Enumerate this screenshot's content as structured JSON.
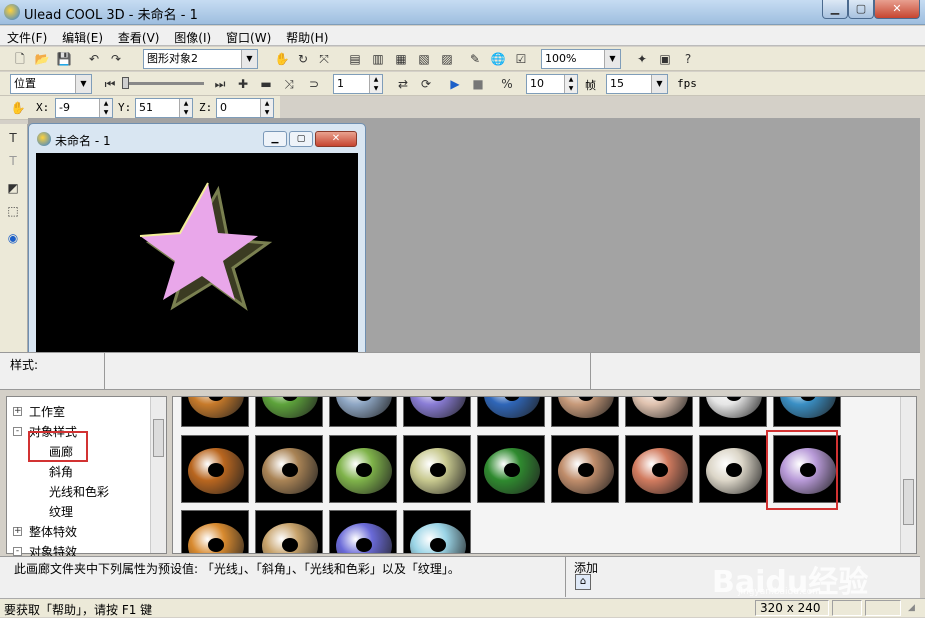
{
  "window": {
    "title": "Ulead COOL 3D - 未命名 - 1"
  },
  "menu": [
    "文件(F)",
    "编辑(E)",
    "查看(V)",
    "图像(I)",
    "窗口(W)",
    "帮助(H)"
  ],
  "toolbar1": {
    "object_select": "图形对象2",
    "zoom": "100%"
  },
  "toolbar2": {
    "mode_select": "位置",
    "frame": "1",
    "frames_total": "10",
    "frames_label": "帧",
    "fps_value": "15",
    "fps_label": "fps"
  },
  "toolbar3": {
    "x_label": "X:",
    "x_value": "-9",
    "y_label": "Y:",
    "y_value": "51",
    "z_label": "Z:",
    "z_value": "0"
  },
  "document": {
    "title": "未命名 - 1"
  },
  "style_panel": {
    "label": "样式:"
  },
  "tree": {
    "items": [
      {
        "label": "工作室",
        "expander": "+"
      },
      {
        "label": "对象样式",
        "expander": "-"
      },
      {
        "label": "画廊"
      },
      {
        "label": "斜角"
      },
      {
        "label": "光线和色彩"
      },
      {
        "label": "纹理"
      },
      {
        "label": "整体特效",
        "expander": "+"
      },
      {
        "label": "对象特效",
        "expander": "-"
      }
    ]
  },
  "gallery": {
    "row1_colors": [
      "#c77a2a",
      "#5da33b",
      "#8fa7c4",
      "#8a7dd6",
      "#2f66b8",
      "#c79a7a",
      "#e0c3b0",
      "#e6e6e6",
      "#3a8fc4"
    ],
    "row2_colors": [
      "#b9661f",
      "#a98355",
      "#7fb34a",
      "#c8c98f",
      "#2f8a2f",
      "#c08d6b",
      "#d17b5f",
      "#dcd6c8",
      "#b89ad8"
    ],
    "row3_colors": [
      "#d88a2f",
      "#c7a26a",
      "#6a6ad8",
      "#9ad4e6"
    ]
  },
  "description": {
    "text": "此画廊文件夹中下列属性为预设值: 「光线」、「斜角」、「光线和色彩」以及「纹理」。",
    "add_label": "添加"
  },
  "status": {
    "help": "要获取「帮助」，请按 F1 键",
    "size": "320 x 240"
  },
  "watermark": {
    "text": "Baidu经验",
    "url": "jingyan.baidu.com"
  }
}
